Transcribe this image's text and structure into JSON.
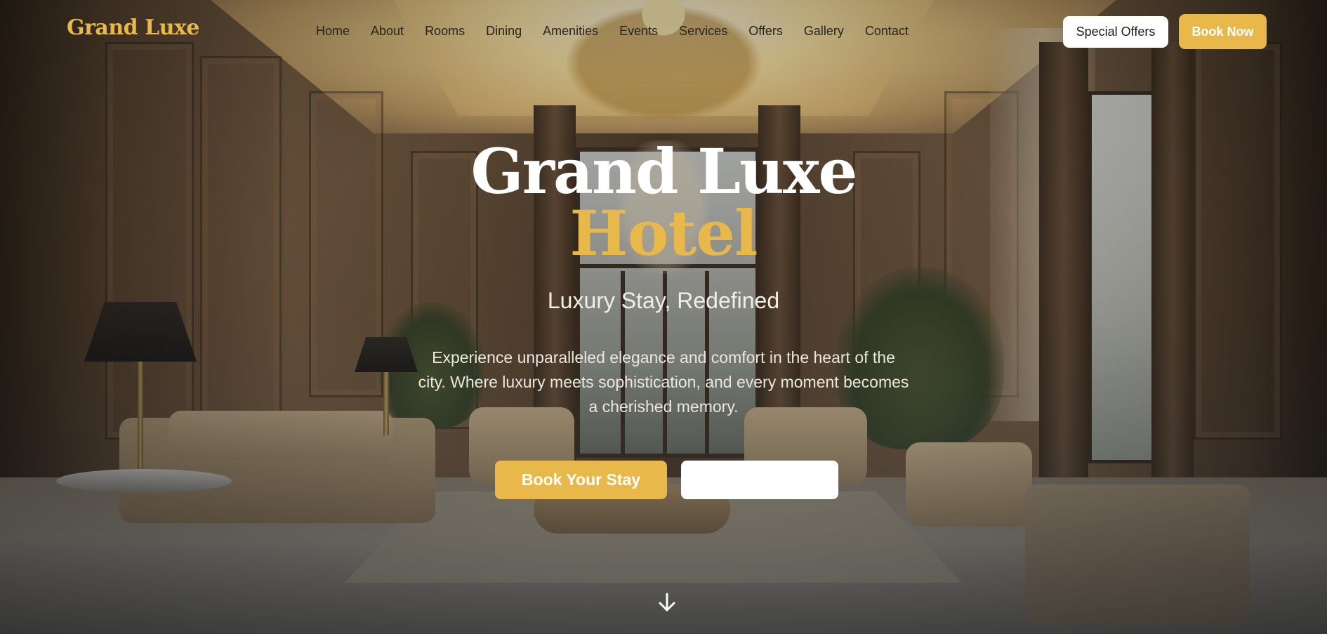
{
  "brand": {
    "name": "Grand Luxe"
  },
  "nav": {
    "items": [
      {
        "label": "Home"
      },
      {
        "label": "About"
      },
      {
        "label": "Rooms"
      },
      {
        "label": "Dining"
      },
      {
        "label": "Amenities"
      },
      {
        "label": "Events"
      },
      {
        "label": "Services"
      },
      {
        "label": "Offers"
      },
      {
        "label": "Gallery"
      },
      {
        "label": "Contact"
      }
    ],
    "special_offers_label": "Special Offers",
    "book_now_label": "Book Now"
  },
  "hero": {
    "title_line1": "Grand Luxe",
    "title_line2": "Hotel",
    "subtitle": "Luxury Stay, Redefined",
    "description": "Experience unparalleled elegance and comfort in the heart of the city. Where luxury meets sophistication, and every moment becomes a cherished memory.",
    "primary_cta": "Book Your Stay",
    "secondary_cta": "",
    "scroll_icon": "arrow-down-icon"
  },
  "colors": {
    "accent": "#e8b84a",
    "nav_text": "#2a241e",
    "hero_text": "#ffffff"
  }
}
